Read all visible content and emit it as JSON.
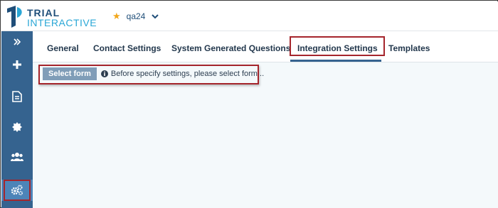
{
  "brand": {
    "line1": "TRIAL",
    "line2": "INTERACTIVE",
    "colors": {
      "dark": "#1f4e79",
      "light": "#2aa7d6"
    }
  },
  "header": {
    "project_name": "qa24",
    "star_icon": "star-icon",
    "dropdown_icon": "chevron-down-icon"
  },
  "sidebar": {
    "items": [
      {
        "icon": "expand-chevrons-icon"
      },
      {
        "icon": "plus-icon"
      },
      {
        "icon": "document-icon"
      },
      {
        "icon": "badge-icon"
      },
      {
        "icon": "users-icon"
      },
      {
        "icon": "settings-gears-icon",
        "active": true
      }
    ],
    "colors": {
      "bg": "#35638f",
      "active": "#4d84b8"
    }
  },
  "tabs": [
    {
      "label": "General"
    },
    {
      "label": "Contact Settings"
    },
    {
      "label": "System Generated Questions"
    },
    {
      "label": "Integration Settings",
      "active": true
    },
    {
      "label": "Templates"
    }
  ],
  "content": {
    "select_button_label": "Select form",
    "info_icon": "info-icon",
    "info_text": "Before specify settings, please select form..."
  },
  "highlight_color": "#a5252c"
}
